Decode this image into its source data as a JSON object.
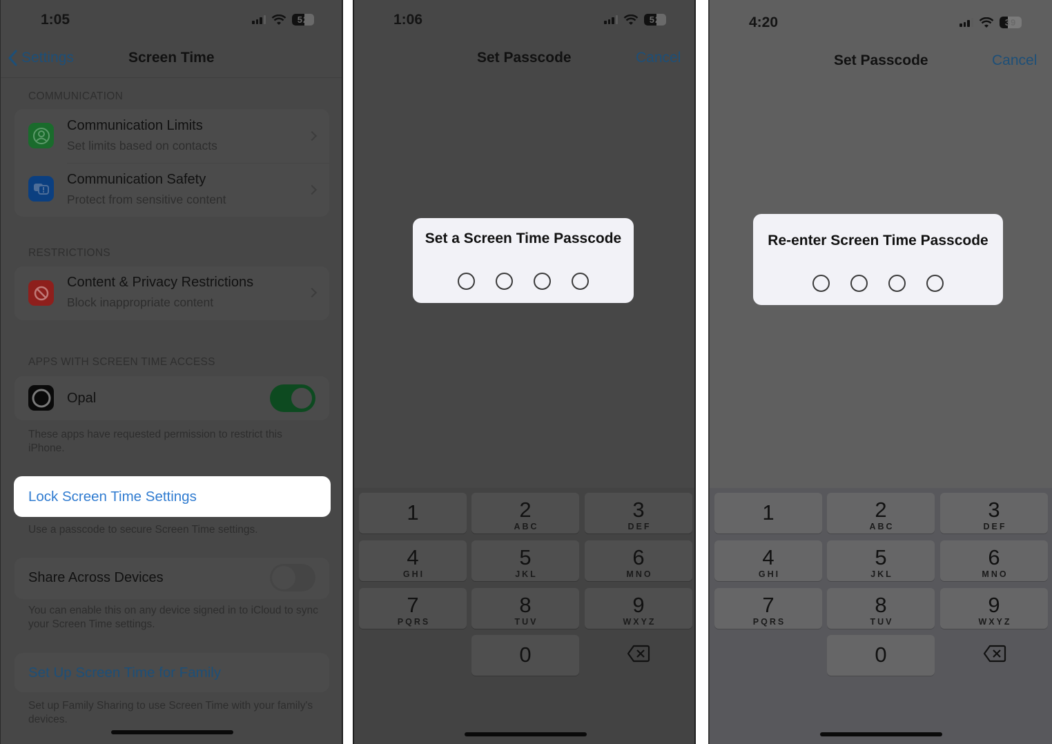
{
  "panel1": {
    "status": {
      "time": "1:05",
      "battery": "52"
    },
    "nav": {
      "back_label": "Settings",
      "title": "Screen Time"
    },
    "sections": {
      "communication": "COMMUNICATION",
      "restrictions": "RESTRICTIONS",
      "apps_access": "APPS WITH SCREEN TIME ACCESS"
    },
    "rows": {
      "comm_limits": {
        "title": "Communication Limits",
        "subtitle": "Set limits based on contacts",
        "icon": "person-circle-icon",
        "color": "#1a6b2c"
      },
      "comm_safety": {
        "title": "Communication Safety",
        "subtitle": "Protect from sensitive content",
        "icon": "chat-bubbles-warning-icon",
        "color": "#0b3f80"
      },
      "content_privacy": {
        "title": "Content & Privacy Restrictions",
        "subtitle": "Block inappropriate content",
        "icon": "no-entry-icon",
        "color": "#8e1f1c"
      },
      "opal": {
        "title": "Opal",
        "icon": "opal-app-icon",
        "toggle_on": true
      }
    },
    "apps_footnote": "These apps have requested permission to restrict this iPhone.",
    "lock_settings": {
      "label": "Lock Screen Time Settings",
      "footnote": "Use a passcode to secure Screen Time settings."
    },
    "share_devices": {
      "label": "Share Across Devices",
      "toggle_on": false,
      "footnote": "You can enable this on any device signed in to iCloud to sync your Screen Time settings."
    },
    "family": {
      "label": "Set Up Screen Time for Family",
      "footnote": "Set up Family Sharing to use Screen Time with your family's devices."
    }
  },
  "panel2": {
    "status": {
      "time": "1:06",
      "battery": "52"
    },
    "nav": {
      "title": "Set Passcode",
      "cancel_label": "Cancel"
    },
    "dialog": {
      "title": "Set a Screen Time Passcode",
      "digits_entered": 0,
      "digits_total": 4
    }
  },
  "panel3": {
    "status": {
      "time": "4:20",
      "battery": "39"
    },
    "nav": {
      "title": "Set Passcode",
      "cancel_label": "Cancel"
    },
    "dialog": {
      "title": "Re-enter Screen Time Passcode",
      "digits_entered": 0,
      "digits_total": 4
    }
  },
  "keypad": {
    "keys": [
      {
        "num": "1",
        "letters": ""
      },
      {
        "num": "2",
        "letters": "ABC"
      },
      {
        "num": "3",
        "letters": "DEF"
      },
      {
        "num": "4",
        "letters": "GHI"
      },
      {
        "num": "5",
        "letters": "JKL"
      },
      {
        "num": "6",
        "letters": "MNO"
      },
      {
        "num": "7",
        "letters": "PQRS"
      },
      {
        "num": "8",
        "letters": "TUV"
      },
      {
        "num": "9",
        "letters": "WXYZ"
      },
      {
        "num": "0",
        "letters": ""
      }
    ],
    "delete_icon": "backspace-icon"
  },
  "colors": {
    "accent_blue": "#2f7bd0",
    "dimmed_blue": "#1d4f78",
    "toggle_green": "#0d4a20",
    "dialog_bg": "#f2f2f7"
  }
}
